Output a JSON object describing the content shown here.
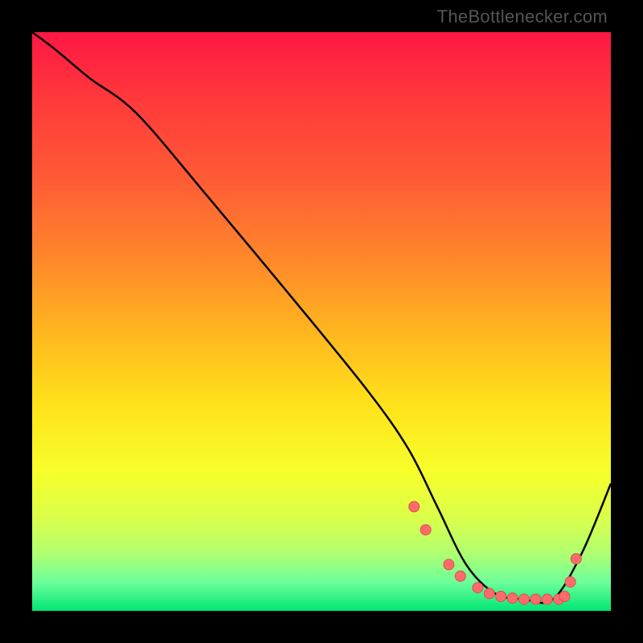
{
  "attribution": "TheBottlenecker.com",
  "chart_data": {
    "type": "line",
    "title": "",
    "xlabel": "",
    "ylabel": "",
    "xlim": [
      0,
      100
    ],
    "ylim": [
      0,
      100
    ],
    "curve": {
      "x": [
        0,
        4,
        10,
        18,
        30,
        45,
        58,
        65,
        70,
        75,
        80,
        85,
        90,
        95,
        100
      ],
      "y": [
        100,
        97,
        92,
        86,
        72,
        54,
        38,
        28,
        18,
        8,
        3,
        2,
        2,
        10,
        22
      ]
    },
    "markers": {
      "x": [
        66,
        68,
        72,
        74,
        77,
        79,
        81,
        83,
        85,
        87,
        89,
        91,
        92,
        93,
        94
      ],
      "y": [
        18,
        14,
        8,
        6,
        4,
        3,
        2.5,
        2.2,
        2,
        2,
        2,
        2,
        2.5,
        5,
        9
      ]
    },
    "colors": {
      "line": "#000000",
      "marker_fill": "#ff6b6b",
      "marker_stroke": "#d94f4f"
    }
  }
}
